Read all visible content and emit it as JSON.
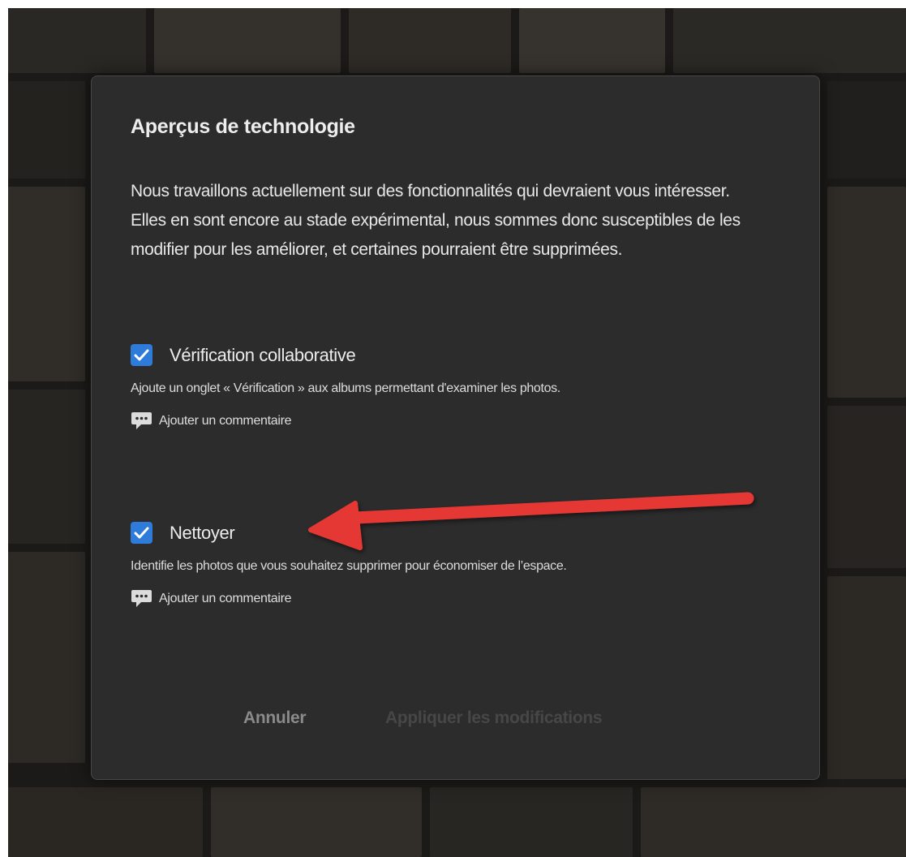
{
  "dialog": {
    "title": "Aperçus de technologie",
    "intro": "Nous travaillons actuellement sur des fonctionnalités qui devraient vous intéresser. Elles en sont encore au stade expérimental, nous sommes donc susceptibles de les modifier pour les améliorer, et certaines pourraient être supprimées.",
    "features": [
      {
        "name": "Vérification collaborative",
        "checked": true,
        "description": "Ajoute un onglet « Vérification » aux albums permettant d'examiner les photos.",
        "comment_label": "Ajouter un commentaire"
      },
      {
        "name": "Nettoyer",
        "checked": true,
        "description": "Identifie les photos que vous souhaitez supprimer pour économiser de l’espace.",
        "comment_label": "Ajouter un commentaire"
      }
    ],
    "buttons": {
      "cancel": "Annuler",
      "apply": "Appliquer les modifications"
    }
  },
  "icons": {
    "checkbox": "checkmark-icon",
    "comment": "speech-bubble-icon"
  },
  "colors": {
    "dialog_bg": "#2c2c2c",
    "checkbox_accent": "#2f7bd9",
    "annotation_arrow": "#e53935"
  }
}
